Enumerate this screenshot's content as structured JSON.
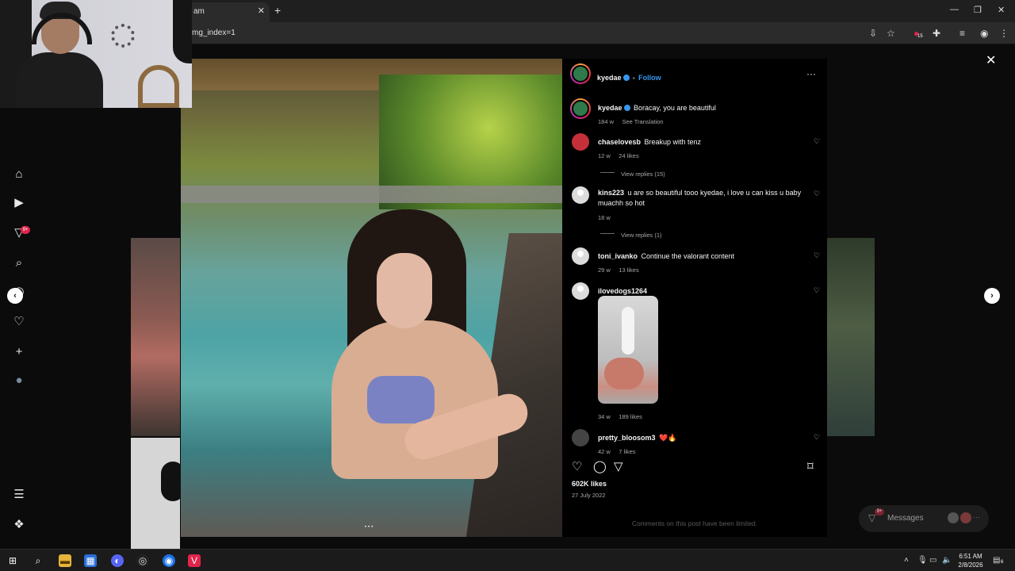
{
  "browser": {
    "tab_title": "am",
    "tab_close": "✕",
    "new_tab": "+",
    "url": "mg_index=1",
    "ext_badge": "15",
    "window_minimize": "—",
    "window_restore": "❐",
    "window_close": "✕"
  },
  "sidenav": {
    "badge": "9+",
    "items": [
      "home-icon",
      "reels-icon",
      "direct-icon",
      "search-icon",
      "explore-icon",
      "notifications-icon",
      "create-icon",
      "profile-icon",
      "more-icon",
      "threads-icon"
    ]
  },
  "post": {
    "author": "kyedae",
    "follow_label": "Follow",
    "separator": "•",
    "more_label": "···",
    "caption_user": "kyedae",
    "caption": "Boracay, you are beautiful",
    "caption_age": "184 w",
    "see_translation": "See Translation",
    "likes": "602K likes",
    "date": "27 July 2022",
    "limited_notice": "Comments on this post have been limited.",
    "carousel_dots": "•••"
  },
  "comments": [
    {
      "user": "chaselovesb",
      "text": "Breakup with tenz",
      "age": "12 w",
      "likes": "24 likes",
      "replies": "View replies (15)"
    },
    {
      "user": "kins223",
      "text": "u are so beautiful tooo kyedae, i love u can kiss u baby muachh so hot",
      "age": "18 w",
      "likes": "",
      "replies": "View replies (1)"
    },
    {
      "user": "toni_ivanko",
      "text": "Continue the valorant content",
      "age": "29 w",
      "likes": "13 likes",
      "replies": ""
    },
    {
      "user": "ilovedogs1264",
      "text": "",
      "age": "34 w",
      "likes": "189 likes",
      "replies": ""
    },
    {
      "user": "pretty_bloosom3",
      "text": "❤️🔥",
      "age": "42 w",
      "likes": "7 likes",
      "replies": ""
    }
  ],
  "overlay": {
    "close": "✕",
    "prev": "‹",
    "next": "›"
  },
  "messages": {
    "label": "Messages",
    "badge": "9+",
    "more": "···"
  },
  "taskbar": {
    "time": "6:51 AM",
    "date": "2/8/2026",
    "notif_count": "6"
  },
  "colors": {
    "accent": "#3797f0",
    "badge": "#e0244a",
    "panel_bg": "#000000",
    "backdrop": "#0b0b0b"
  }
}
